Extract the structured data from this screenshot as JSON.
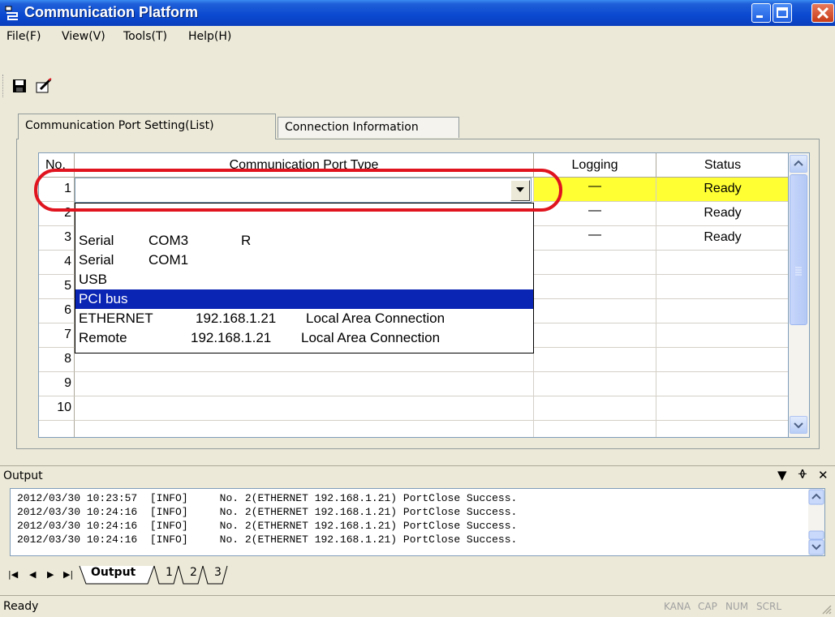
{
  "window": {
    "title": "Communication Platform"
  },
  "menu": [
    "File(F)",
    "View(V)",
    "Tools(T)",
    "Help(H)"
  ],
  "tabs": [
    "Communication Port Setting(List)",
    "Connection Information"
  ],
  "grid": {
    "headers": {
      "no": "No.",
      "type": "Communication Port Type",
      "logging": "Logging",
      "status": "Status"
    },
    "rows": [
      {
        "no": "1",
        "logging": "—",
        "status": "Ready"
      },
      {
        "no": "2",
        "logging": "—",
        "status": "Ready"
      },
      {
        "no": "3",
        "logging": "—",
        "status": "Ready"
      },
      {
        "no": "4",
        "logging": "",
        "status": ""
      },
      {
        "no": "5",
        "logging": "",
        "status": ""
      },
      {
        "no": "6",
        "logging": "",
        "status": ""
      },
      {
        "no": "7",
        "logging": "",
        "status": ""
      },
      {
        "no": "8",
        "logging": "",
        "status": ""
      },
      {
        "no": "9",
        "logging": "",
        "status": ""
      },
      {
        "no": "10",
        "logging": "",
        "status": ""
      }
    ]
  },
  "dropdown": {
    "items": [
      {
        "kind": "Serial",
        "addr": "COM3",
        "extra": "R"
      },
      {
        "kind": "Serial",
        "addr": "COM1",
        "extra": ""
      },
      {
        "kind": "USB",
        "addr": "",
        "extra": ""
      },
      {
        "kind": "PCI bus",
        "addr": "",
        "extra": ""
      },
      {
        "kind": "ETHERNET",
        "addr": "192.168.1.21",
        "extra": "Local Area Connection"
      },
      {
        "kind": "Remote",
        "addr": "192.168.1.21",
        "extra": "Local Area Connection"
      }
    ],
    "highlighted_index": 3
  },
  "output": {
    "title": "Output",
    "lines": [
      {
        "time": "2012/03/30 10:23:57",
        "level": "[INFO]",
        "msg": "No. 2(ETHERNET 192.168.1.21) PortClose Success."
      },
      {
        "time": "2012/03/30 10:24:16",
        "level": "[INFO]",
        "msg": "No. 2(ETHERNET 192.168.1.21) PortClose Success."
      },
      {
        "time": "2012/03/30 10:24:16",
        "level": "[INFO]",
        "msg": "No. 2(ETHERNET 192.168.1.21) PortClose Success."
      },
      {
        "time": "2012/03/30 10:24:16",
        "level": "[INFO]",
        "msg": "No. 2(ETHERNET 192.168.1.21) PortClose Success."
      }
    ],
    "tabs": [
      "Output",
      "1",
      "2",
      "3"
    ]
  },
  "statusbar": {
    "text": "Ready",
    "indicators": [
      "KANA",
      "CAP",
      "NUM",
      "SCRL"
    ]
  },
  "colors": {
    "title_bar": "#0a49d0",
    "selected_status": "#ffff33",
    "highlight": "#0a24b4",
    "callout": "#e0141e"
  }
}
